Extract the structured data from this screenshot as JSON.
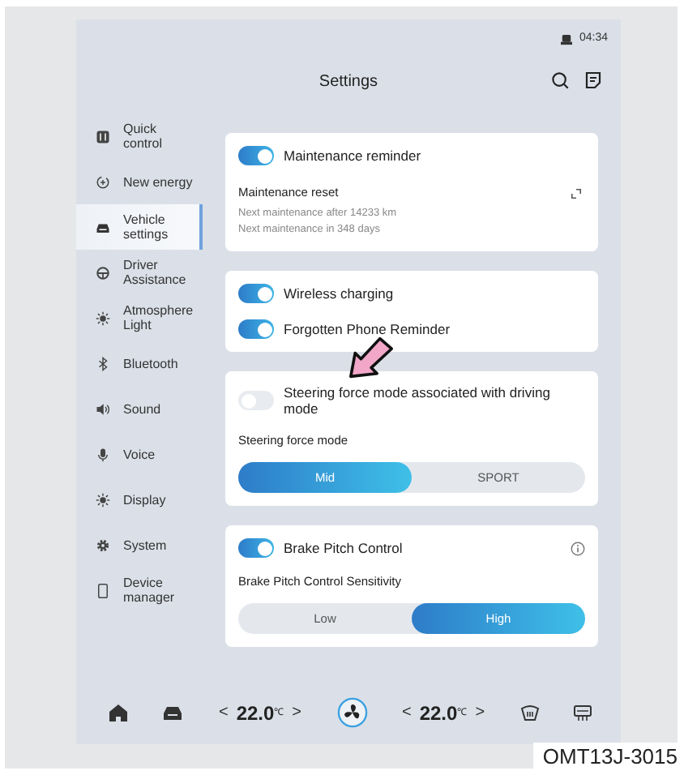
{
  "status_bar": {
    "time": "04:34"
  },
  "header": {
    "title": "Settings"
  },
  "sidebar": {
    "items": [
      {
        "label": "Quick control",
        "selected": false
      },
      {
        "label": "New energy",
        "selected": false
      },
      {
        "label": "Vehicle settings",
        "selected": true
      },
      {
        "label": "Driver Assistance",
        "selected": false
      },
      {
        "label": "Atmosphere Light",
        "selected": false
      },
      {
        "label": "Bluetooth",
        "selected": false
      },
      {
        "label": "Sound",
        "selected": false
      },
      {
        "label": "Voice",
        "selected": false
      },
      {
        "label": "Display",
        "selected": false
      },
      {
        "label": "System",
        "selected": false
      },
      {
        "label": "Device manager",
        "selected": false
      }
    ]
  },
  "cards": [
    {
      "items": [
        {
          "kind": "toggle",
          "label": "Maintenance reminder",
          "on": true
        },
        {
          "kind": "action",
          "title": "Maintenance reset",
          "lines": [
            "Next maintenance after 14233 km",
            "Next maintenance in 348 days"
          ]
        }
      ]
    },
    {
      "items": [
        {
          "kind": "toggle",
          "label": "Wireless charging",
          "on": true
        },
        {
          "kind": "toggle",
          "label": "Forgotten Phone Reminder",
          "on": true
        }
      ]
    },
    {
      "items": [
        {
          "kind": "toggle",
          "label": "Steering force mode associated with driving mode",
          "on": false
        },
        {
          "kind": "label",
          "text": "Steering force mode"
        },
        {
          "kind": "segmented",
          "options": [
            {
              "label": "Mid",
              "selected": true
            },
            {
              "label": "SPORT",
              "selected": false
            }
          ]
        }
      ]
    },
    {
      "items": [
        {
          "kind": "toggle_info",
          "label": "Brake Pitch Control",
          "on": true
        },
        {
          "kind": "label",
          "text": "Brake Pitch Control Sensitivity"
        },
        {
          "kind": "segmented",
          "options": [
            {
              "label": "Low",
              "selected": false
            },
            {
              "label": "High",
              "selected": true
            }
          ]
        }
      ]
    }
  ],
  "climate_bar": {
    "left_temp": {
      "decrease": "<",
      "value": "22.0$^{℃}$",
      "increase": ">"
    },
    "right_temp": {
      "decrease": "<",
      "value": "22.0$^{℃}$",
      "increase": ">"
    }
  },
  "caption": "OMT13J-3015"
}
